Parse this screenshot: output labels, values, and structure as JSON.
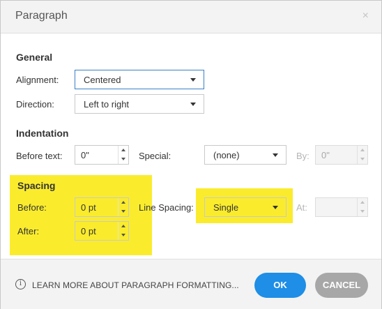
{
  "dialog": {
    "title": "Paragraph",
    "close_glyph": "×"
  },
  "general": {
    "heading": "General",
    "alignment_label": "Alignment:",
    "alignment_value": "Centered",
    "direction_label": "Direction:",
    "direction_value": "Left to right"
  },
  "indentation": {
    "heading": "Indentation",
    "before_text_label": "Before text:",
    "before_text_value": "0\"",
    "special_label": "Special:",
    "special_value": "(none)",
    "by_label": "By:",
    "by_value": "0\""
  },
  "spacing": {
    "heading": "Spacing",
    "before_label": "Before:",
    "before_value": "0 pt",
    "after_label": "After:",
    "after_value": "0 pt",
    "line_spacing_label": "Line Spacing:",
    "line_spacing_value": "Single",
    "at_label": "At:",
    "at_value": "",
    "highlight_color": "#faec2d"
  },
  "footer": {
    "info_icon": "info-icon",
    "learn_more": "LEARN MORE ABOUT PARAGRAPH FORMATTING...",
    "ok_label": "OK",
    "cancel_label": "CANCEL",
    "ok_color": "#1e8ee6",
    "cancel_color": "#a7a7a7"
  }
}
